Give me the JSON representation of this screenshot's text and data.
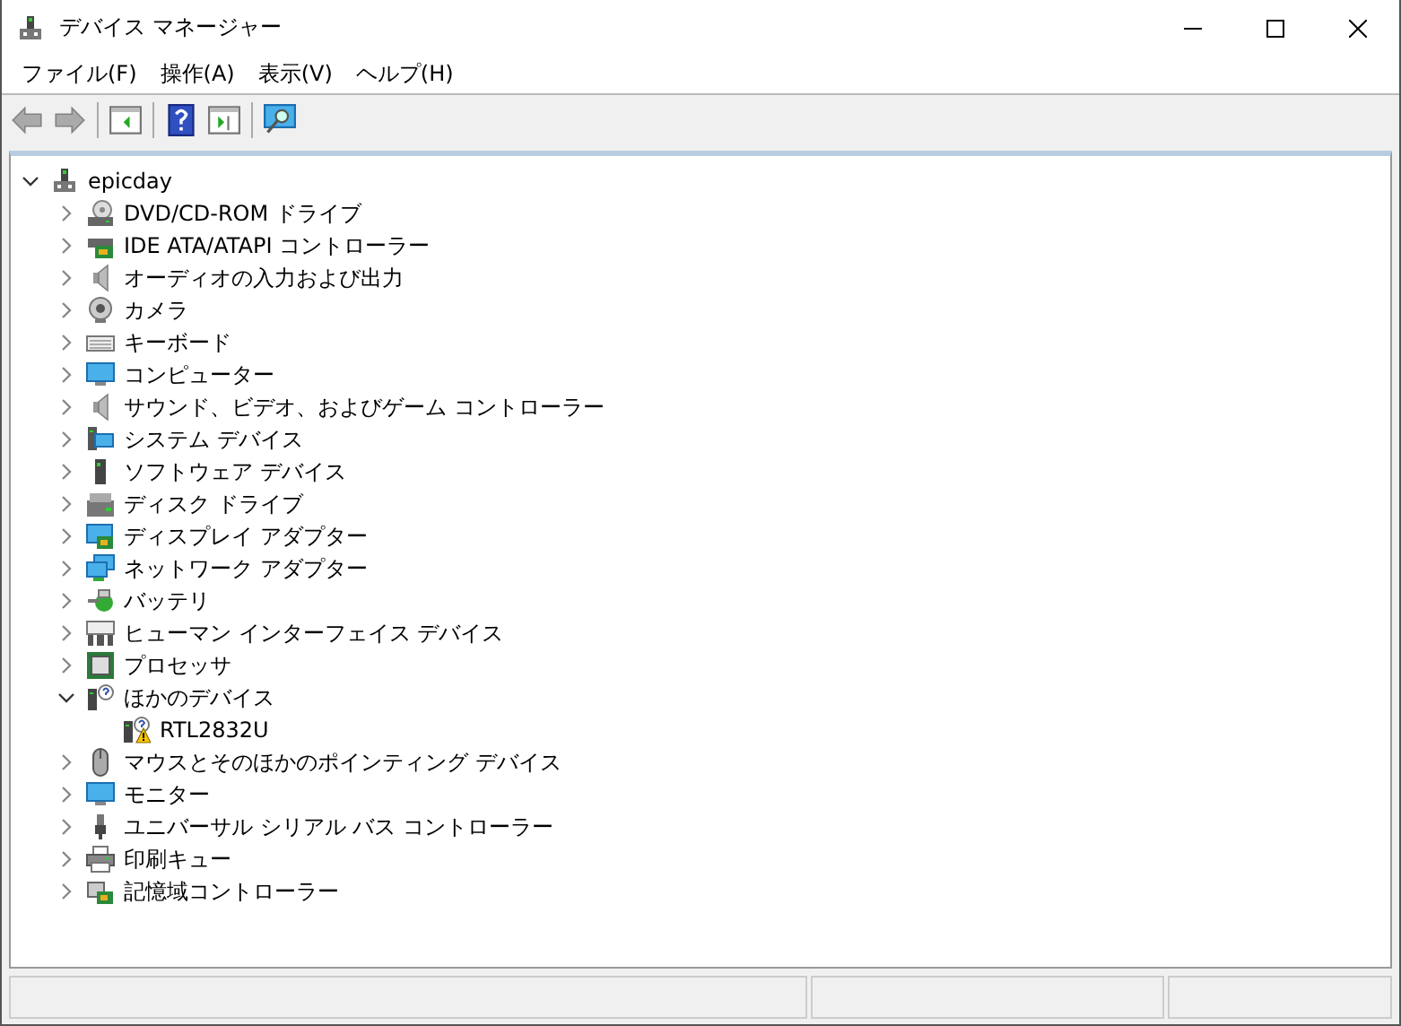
{
  "window": {
    "title": "デバイス マネージャー"
  },
  "menu": [
    "ファイル(F)",
    "操作(A)",
    "表示(V)",
    "ヘルプ(H)"
  ],
  "toolbar": [
    {
      "kind": "back",
      "disabled": true
    },
    {
      "kind": "forward",
      "disabled": true
    },
    {
      "kind": "separator"
    },
    {
      "kind": "console-tree",
      "disabled": false
    },
    {
      "kind": "separator"
    },
    {
      "kind": "help",
      "disabled": false
    },
    {
      "kind": "action-pane",
      "disabled": false
    },
    {
      "kind": "separator"
    },
    {
      "kind": "scan",
      "disabled": false
    }
  ],
  "tree": {
    "label": "epicday",
    "kind": "computer",
    "expanded": true,
    "children": [
      {
        "label": "DVD/CD-ROM ドライブ",
        "kind": "dvd",
        "expanded": false
      },
      {
        "label": "IDE ATA/ATAPI コントローラー",
        "kind": "card",
        "expanded": false
      },
      {
        "label": "オーディオの入力および出力",
        "kind": "speaker",
        "expanded": false
      },
      {
        "label": "カメラ",
        "kind": "camera",
        "expanded": false
      },
      {
        "label": "キーボード",
        "kind": "keyboard",
        "expanded": false
      },
      {
        "label": "コンピューター",
        "kind": "monitor",
        "expanded": false
      },
      {
        "label": "サウンド、ビデオ、およびゲーム コントローラー",
        "kind": "speaker",
        "expanded": false
      },
      {
        "label": "システム デバイス",
        "kind": "system",
        "expanded": false
      },
      {
        "label": "ソフトウェア デバイス",
        "kind": "software",
        "expanded": false
      },
      {
        "label": "ディスク ドライブ",
        "kind": "disk",
        "expanded": false
      },
      {
        "label": "ディスプレイ アダプター",
        "kind": "display",
        "expanded": false
      },
      {
        "label": "ネットワーク アダプター",
        "kind": "network",
        "expanded": false
      },
      {
        "label": "バッテリ",
        "kind": "battery",
        "expanded": false
      },
      {
        "label": "ヒューマン インターフェイス デバイス",
        "kind": "hid",
        "expanded": false
      },
      {
        "label": "プロセッサ",
        "kind": "processor",
        "expanded": false
      },
      {
        "label": "ほかのデバイス",
        "kind": "unknown",
        "expanded": true,
        "children": [
          {
            "label": "RTL2832U",
            "kind": "unknown",
            "warning": true
          }
        ]
      },
      {
        "label": "マウスとそのほかのポインティング デバイス",
        "kind": "mouse",
        "expanded": false
      },
      {
        "label": "モニター",
        "kind": "monitor",
        "expanded": false
      },
      {
        "label": "ユニバーサル シリアル バス コントローラー",
        "kind": "usb",
        "expanded": false
      },
      {
        "label": "印刷キュー",
        "kind": "printer",
        "expanded": false
      },
      {
        "label": "記憶域コントローラー",
        "kind": "storage",
        "expanded": false
      }
    ]
  }
}
